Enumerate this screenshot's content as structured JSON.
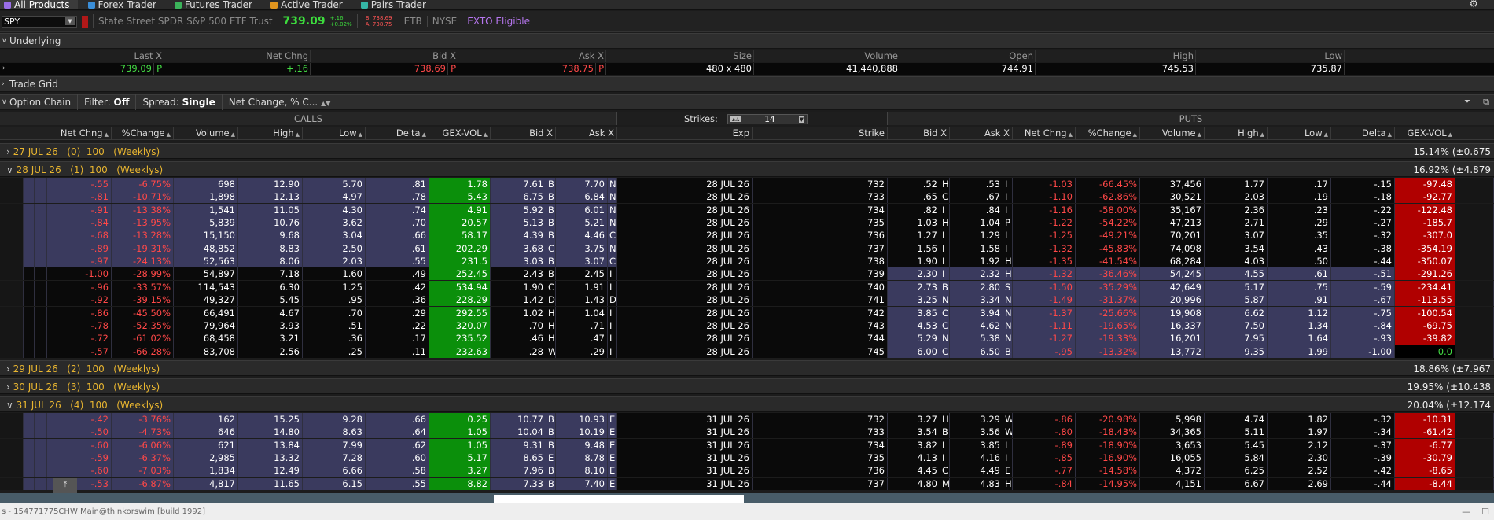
{
  "nav": {
    "tabs": [
      {
        "label": "All Products",
        "color": "#9a6ee8"
      },
      {
        "label": "Forex Trader",
        "color": "#3a8ed8"
      },
      {
        "label": "Futures Trader",
        "color": "#3bb35a"
      },
      {
        "label": "Active Trader",
        "color": "#e0951e"
      },
      {
        "label": "Pairs Trader",
        "color": "#35b5a5"
      }
    ]
  },
  "symbol_bar": {
    "symbol": "SPY",
    "description": "State Street SPDR S&P 500 ETF Trust",
    "last": "739.09",
    "chg_line1": "+.16",
    "chg_line2": "+0.02%",
    "bid_line": "B: 738.69",
    "ask_line": "A: 738.75",
    "badges": [
      "ETB",
      "NYSE"
    ],
    "exto": "EXTO Eligible"
  },
  "underlying": {
    "title": "Underlying",
    "headers": [
      "Last X",
      "Net Chng",
      "Bid X",
      "Ask X",
      "Size",
      "Volume",
      "Open",
      "High",
      "Low"
    ],
    "values": {
      "last": "739.09",
      "last_ex": "P",
      "net_chng": "+.16",
      "bid": "738.69",
      "bid_ex": "P",
      "ask": "738.75",
      "ask_ex": "P",
      "size": "480 x 480",
      "volume": "41,440,888",
      "open": "744.91",
      "high": "745.53",
      "low": "735.87"
    }
  },
  "trade_grid": {
    "title": "Trade Grid"
  },
  "option_chain": {
    "title": "Option Chain",
    "filter_label": "Filter:",
    "filter_value": "Off",
    "spread_label": "Spread:",
    "spread_value": "Single",
    "layout_value": "Net Change, % C...",
    "calls_label": "CALLS",
    "puts_label": "PUTS",
    "strikes_label": "Strikes:",
    "strikes_value": "14",
    "call_headers": [
      "Net Chng",
      "%Change",
      "Volume",
      "High",
      "Low",
      "Delta",
      "GEX-VOL",
      "Bid X",
      "Ask X"
    ],
    "mid_headers": [
      "Exp",
      "Strike"
    ],
    "put_headers": [
      "Bid X",
      "Ask X",
      "Net Chng",
      "%Change",
      "Volume",
      "High",
      "Low",
      "Delta",
      "GEX-VOL"
    ],
    "expirations": [
      {
        "label": "27 JUL 26",
        "dte": "(0)",
        "mult": "100",
        "type": "(Weeklys)",
        "iv": "15.14%",
        "iv_range": "(±0.675",
        "expanded": false
      },
      {
        "label": "28 JUL 26",
        "dte": "(1)",
        "mult": "100",
        "type": "(Weeklys)",
        "iv": "16.92%",
        "iv_range": "(±4.879",
        "expanded": true
      },
      {
        "label": "29 JUL 26",
        "dte": "(2)",
        "mult": "100",
        "type": "(Weeklys)",
        "iv": "18.86%",
        "iv_range": "(±7.967",
        "expanded": false
      },
      {
        "label": "30 JUL 26",
        "dte": "(3)",
        "mult": "100",
        "type": "(Weeklys)",
        "iv": "19.95%",
        "iv_range": "(±10.438",
        "expanded": false
      },
      {
        "label": "31 JUL 26",
        "dte": "(4)",
        "mult": "100",
        "type": "(Weeklys)",
        "iv": "20.04%",
        "iv_range": "(±12.174",
        "expanded": true
      }
    ],
    "rows_28jul": [
      {
        "c": [
          "-.55",
          "-6.75%",
          "698",
          "12.90",
          "5.70",
          ".81",
          "1.78",
          "7.61",
          "B",
          "7.70",
          "N"
        ],
        "exp": "28 JUL 26",
        "strike": "732",
        "p": [
          ".52",
          "H",
          ".53",
          "I",
          "-1.03",
          "-66.45%",
          "37,456",
          "1.77",
          ".17",
          "-.15",
          "-97.48"
        ],
        "itm": true
      },
      {
        "c": [
          "-.81",
          "-10.71%",
          "1,898",
          "12.13",
          "4.97",
          ".78",
          "5.43",
          "6.75",
          "B",
          "6.84",
          "N"
        ],
        "exp": "28 JUL 26",
        "strike": "733",
        "p": [
          ".65",
          "C",
          ".67",
          "I",
          "-1.10",
          "-62.86%",
          "30,521",
          "2.03",
          ".19",
          "-.18",
          "-92.77"
        ],
        "itm": true
      },
      {
        "c": [
          "-.91",
          "-13.38%",
          "1,541",
          "11.05",
          "4.30",
          ".74",
          "4.91",
          "5.92",
          "B",
          "6.01",
          "N"
        ],
        "exp": "28 JUL 26",
        "strike": "734",
        "p": [
          ".82",
          "I",
          ".84",
          "I",
          "-1.16",
          "-58.00%",
          "35,167",
          "2.36",
          ".23",
          "-.22",
          "-122.48"
        ],
        "itm": true
      },
      {
        "c": [
          "-.84",
          "-13.95%",
          "5,839",
          "10.76",
          "3.62",
          ".70",
          "20.57",
          "5.13",
          "B",
          "5.21",
          "N"
        ],
        "exp": "28 JUL 26",
        "strike": "735",
        "p": [
          "1.03",
          "H",
          "1.04",
          "P",
          "-1.22",
          "-54.22%",
          "47,213",
          "2.71",
          ".29",
          "-.27",
          "-185.7"
        ],
        "itm": true
      },
      {
        "c": [
          "-.68",
          "-13.28%",
          "15,150",
          "9.68",
          "3.04",
          ".66",
          "58.17",
          "4.39",
          "B",
          "4.46",
          "C"
        ],
        "exp": "28 JUL 26",
        "strike": "736",
        "p": [
          "1.27",
          "I",
          "1.29",
          "I",
          "-1.25",
          "-49.21%",
          "70,201",
          "3.07",
          ".35",
          "-.32",
          "-307.0"
        ],
        "itm": true
      },
      {
        "c": [
          "-.89",
          "-19.31%",
          "48,852",
          "8.83",
          "2.50",
          ".61",
          "202.29",
          "3.68",
          "C",
          "3.75",
          "N"
        ],
        "exp": "28 JUL 26",
        "strike": "737",
        "p": [
          "1.56",
          "I",
          "1.58",
          "I",
          "-1.32",
          "-45.83%",
          "74,098",
          "3.54",
          ".43",
          "-.38",
          "-354.19"
        ],
        "itm": true
      },
      {
        "c": [
          "-.97",
          "-24.13%",
          "52,563",
          "8.06",
          "2.03",
          ".55",
          "231.5",
          "3.03",
          "B",
          "3.07",
          "C"
        ],
        "exp": "28 JUL 26",
        "strike": "738",
        "p": [
          "1.90",
          "I",
          "1.92",
          "H",
          "-1.35",
          "-41.54%",
          "68,284",
          "4.03",
          ".50",
          "-.44",
          "-350.07"
        ],
        "itm": true
      },
      {
        "c": [
          "-1.00",
          "-28.99%",
          "54,897",
          "7.18",
          "1.60",
          ".49",
          "252.45",
          "2.43",
          "B",
          "2.45",
          "I"
        ],
        "exp": "28 JUL 26",
        "strike": "739",
        "p": [
          "2.30",
          "I",
          "2.32",
          "H",
          "-1.32",
          "-36.46%",
          "54,245",
          "4.55",
          ".61",
          "-.51",
          "-291.26"
        ],
        "itm": false
      },
      {
        "c": [
          "-.96",
          "-33.57%",
          "114,543",
          "6.30",
          "1.25",
          ".42",
          "534.94",
          "1.90",
          "C",
          "1.91",
          "I"
        ],
        "exp": "28 JUL 26",
        "strike": "740",
        "p": [
          "2.73",
          "B",
          "2.80",
          "S",
          "-1.50",
          "-35.29%",
          "42,649",
          "5.17",
          ".75",
          "-.59",
          "-234.41"
        ],
        "itm": false
      },
      {
        "c": [
          "-.92",
          "-39.15%",
          "49,327",
          "5.45",
          ".95",
          ".36",
          "228.29",
          "1.42",
          "D",
          "1.43",
          "D"
        ],
        "exp": "28 JUL 26",
        "strike": "741",
        "p": [
          "3.25",
          "N",
          "3.34",
          "N",
          "-1.49",
          "-31.37%",
          "20,996",
          "5.87",
          ".91",
          "-.67",
          "-113.55"
        ],
        "itm": false
      },
      {
        "c": [
          "-.86",
          "-45.50%",
          "66,491",
          "4.67",
          ".70",
          ".29",
          "292.55",
          "1.02",
          "H",
          "1.04",
          "I"
        ],
        "exp": "28 JUL 26",
        "strike": "742",
        "p": [
          "3.85",
          "C",
          "3.94",
          "N",
          "-1.37",
          "-25.66%",
          "19,908",
          "6.62",
          "1.12",
          "-.75",
          "-100.54"
        ],
        "itm": false
      },
      {
        "c": [
          "-.78",
          "-52.35%",
          "79,964",
          "3.93",
          ".51",
          ".22",
          "320.07",
          ".70",
          "H",
          ".71",
          "I"
        ],
        "exp": "28 JUL 26",
        "strike": "743",
        "p": [
          "4.53",
          "C",
          "4.62",
          "N",
          "-1.11",
          "-19.65%",
          "16,337",
          "7.50",
          "1.34",
          "-.84",
          "-69.75"
        ],
        "itm": false
      },
      {
        "c": [
          "-.72",
          "-61.02%",
          "68,458",
          "3.21",
          ".36",
          ".17",
          "235.52",
          ".46",
          "H",
          ".47",
          "I"
        ],
        "exp": "28 JUL 26",
        "strike": "744",
        "p": [
          "5.29",
          "N",
          "5.38",
          "N",
          "-1.27",
          "-19.33%",
          "16,201",
          "7.95",
          "1.64",
          "-.93",
          "-39.82"
        ],
        "itm": false
      },
      {
        "c": [
          "-.57",
          "-66.28%",
          "83,708",
          "2.56",
          ".25",
          ".11",
          "232.63",
          ".28",
          "W",
          ".29",
          "I"
        ],
        "exp": "28 JUL 26",
        "strike": "745",
        "p": [
          "6.00",
          "C",
          "6.50",
          "B",
          "-.95",
          "-13.32%",
          "13,772",
          "9.35",
          "1.99",
          "-1.00",
          "0.0"
        ],
        "itm": false
      }
    ],
    "rows_31jul": [
      {
        "c": [
          "-.42",
          "-3.76%",
          "162",
          "15.25",
          "9.28",
          ".66",
          "0.25",
          "10.77",
          "B",
          "10.93",
          "E"
        ],
        "exp": "31 JUL 26",
        "strike": "732",
        "p": [
          "3.27",
          "H",
          "3.29",
          "W",
          "-.86",
          "-20.98%",
          "5,998",
          "4.74",
          "1.82",
          "-.32",
          "-10.31"
        ],
        "itm": true
      },
      {
        "c": [
          "-.50",
          "-4.73%",
          "646",
          "14.80",
          "8.63",
          ".64",
          "1.05",
          "10.04",
          "B",
          "10.19",
          "E"
        ],
        "exp": "31 JUL 26",
        "strike": "733",
        "p": [
          "3.54",
          "B",
          "3.56",
          "W",
          "-.80",
          "-18.43%",
          "34,365",
          "5.11",
          "1.97",
          "-.34",
          "-61.42"
        ],
        "itm": true
      },
      {
        "c": [
          "-.60",
          "-6.06%",
          "621",
          "13.84",
          "7.99",
          ".62",
          "1.05",
          "9.31",
          "B",
          "9.48",
          "E"
        ],
        "exp": "31 JUL 26",
        "strike": "734",
        "p": [
          "3.82",
          "I",
          "3.85",
          "I",
          "-.89",
          "-18.90%",
          "3,653",
          "5.45",
          "2.12",
          "-.37",
          "-6.77"
        ],
        "itm": true
      },
      {
        "c": [
          "-.59",
          "-6.37%",
          "2,985",
          "13.32",
          "7.28",
          ".60",
          "5.17",
          "8.65",
          "E",
          "8.78",
          "E"
        ],
        "exp": "31 JUL 26",
        "strike": "735",
        "p": [
          "4.13",
          "I",
          "4.16",
          "I",
          "-.85",
          "-16.90%",
          "16,055",
          "5.84",
          "2.30",
          "-.39",
          "-30.79"
        ],
        "itm": true
      },
      {
        "c": [
          "-.60",
          "-7.03%",
          "1,834",
          "12.49",
          "6.66",
          ".58",
          "3.27",
          "7.96",
          "B",
          "8.10",
          "E"
        ],
        "exp": "31 JUL 26",
        "strike": "736",
        "p": [
          "4.45",
          "C",
          "4.49",
          "E",
          "-.77",
          "-14.58%",
          "4,372",
          "6.25",
          "2.52",
          "-.42",
          "-8.65"
        ],
        "itm": true
      },
      {
        "c": [
          "-.53",
          "-6.87%",
          "4,817",
          "11.65",
          "6.15",
          ".55",
          "8.82",
          "7.33",
          "B",
          "7.40",
          "E"
        ],
        "exp": "31 JUL 26",
        "strike": "737",
        "p": [
          "4.80",
          "M",
          "4.83",
          "H",
          "-.84",
          "-14.95%",
          "4,151",
          "6.67",
          "2.69",
          "-.44",
          "-8.44"
        ],
        "itm": true
      }
    ]
  },
  "status_bar": {
    "text": "s - 154771775CHW Main@thinkorswim [build 1992]"
  },
  "colors": {
    "itm_bg": "#3a3a5e",
    "otm_bg": "#0a0a0a",
    "gex_call": "#0b8f0b",
    "gex_put": "#b00000",
    "neg": "#ff4848",
    "pos": "#44dd44",
    "gold": "#e8b530"
  }
}
